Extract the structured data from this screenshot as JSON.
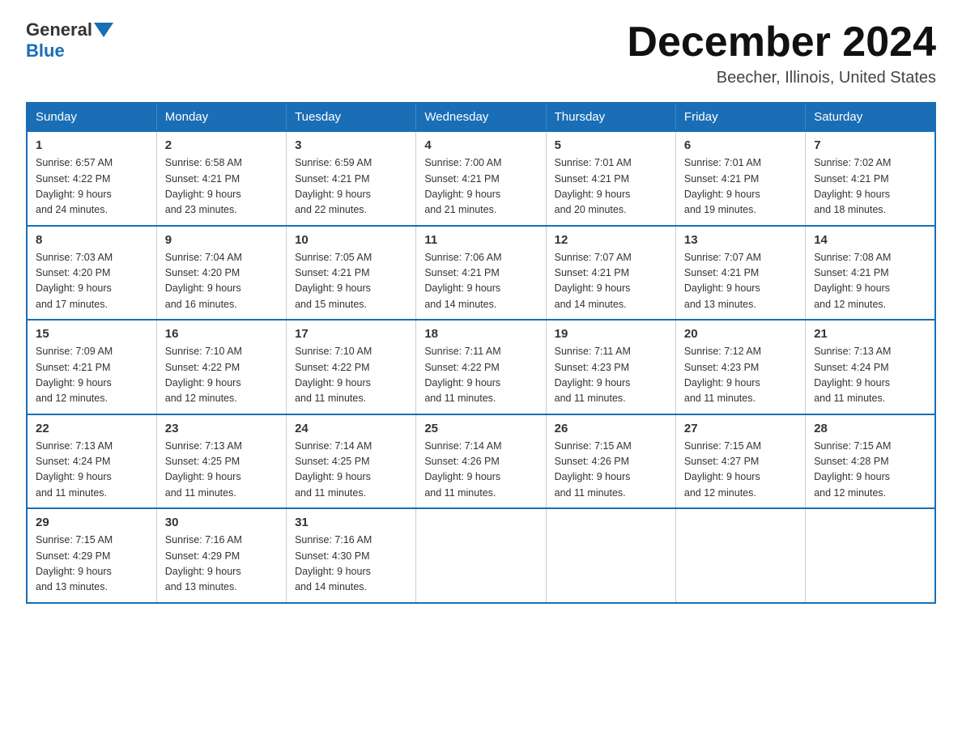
{
  "logo": {
    "general": "General",
    "blue": "Blue"
  },
  "header": {
    "month_year": "December 2024",
    "location": "Beecher, Illinois, United States"
  },
  "days_of_week": [
    "Sunday",
    "Monday",
    "Tuesday",
    "Wednesday",
    "Thursday",
    "Friday",
    "Saturday"
  ],
  "weeks": [
    [
      {
        "day": "1",
        "info": "Sunrise: 6:57 AM\nSunset: 4:22 PM\nDaylight: 9 hours\nand 24 minutes."
      },
      {
        "day": "2",
        "info": "Sunrise: 6:58 AM\nSunset: 4:21 PM\nDaylight: 9 hours\nand 23 minutes."
      },
      {
        "day": "3",
        "info": "Sunrise: 6:59 AM\nSunset: 4:21 PM\nDaylight: 9 hours\nand 22 minutes."
      },
      {
        "day": "4",
        "info": "Sunrise: 7:00 AM\nSunset: 4:21 PM\nDaylight: 9 hours\nand 21 minutes."
      },
      {
        "day": "5",
        "info": "Sunrise: 7:01 AM\nSunset: 4:21 PM\nDaylight: 9 hours\nand 20 minutes."
      },
      {
        "day": "6",
        "info": "Sunrise: 7:01 AM\nSunset: 4:21 PM\nDaylight: 9 hours\nand 19 minutes."
      },
      {
        "day": "7",
        "info": "Sunrise: 7:02 AM\nSunset: 4:21 PM\nDaylight: 9 hours\nand 18 minutes."
      }
    ],
    [
      {
        "day": "8",
        "info": "Sunrise: 7:03 AM\nSunset: 4:20 PM\nDaylight: 9 hours\nand 17 minutes."
      },
      {
        "day": "9",
        "info": "Sunrise: 7:04 AM\nSunset: 4:20 PM\nDaylight: 9 hours\nand 16 minutes."
      },
      {
        "day": "10",
        "info": "Sunrise: 7:05 AM\nSunset: 4:21 PM\nDaylight: 9 hours\nand 15 minutes."
      },
      {
        "day": "11",
        "info": "Sunrise: 7:06 AM\nSunset: 4:21 PM\nDaylight: 9 hours\nand 14 minutes."
      },
      {
        "day": "12",
        "info": "Sunrise: 7:07 AM\nSunset: 4:21 PM\nDaylight: 9 hours\nand 14 minutes."
      },
      {
        "day": "13",
        "info": "Sunrise: 7:07 AM\nSunset: 4:21 PM\nDaylight: 9 hours\nand 13 minutes."
      },
      {
        "day": "14",
        "info": "Sunrise: 7:08 AM\nSunset: 4:21 PM\nDaylight: 9 hours\nand 12 minutes."
      }
    ],
    [
      {
        "day": "15",
        "info": "Sunrise: 7:09 AM\nSunset: 4:21 PM\nDaylight: 9 hours\nand 12 minutes."
      },
      {
        "day": "16",
        "info": "Sunrise: 7:10 AM\nSunset: 4:22 PM\nDaylight: 9 hours\nand 12 minutes."
      },
      {
        "day": "17",
        "info": "Sunrise: 7:10 AM\nSunset: 4:22 PM\nDaylight: 9 hours\nand 11 minutes."
      },
      {
        "day": "18",
        "info": "Sunrise: 7:11 AM\nSunset: 4:22 PM\nDaylight: 9 hours\nand 11 minutes."
      },
      {
        "day": "19",
        "info": "Sunrise: 7:11 AM\nSunset: 4:23 PM\nDaylight: 9 hours\nand 11 minutes."
      },
      {
        "day": "20",
        "info": "Sunrise: 7:12 AM\nSunset: 4:23 PM\nDaylight: 9 hours\nand 11 minutes."
      },
      {
        "day": "21",
        "info": "Sunrise: 7:13 AM\nSunset: 4:24 PM\nDaylight: 9 hours\nand 11 minutes."
      }
    ],
    [
      {
        "day": "22",
        "info": "Sunrise: 7:13 AM\nSunset: 4:24 PM\nDaylight: 9 hours\nand 11 minutes."
      },
      {
        "day": "23",
        "info": "Sunrise: 7:13 AM\nSunset: 4:25 PM\nDaylight: 9 hours\nand 11 minutes."
      },
      {
        "day": "24",
        "info": "Sunrise: 7:14 AM\nSunset: 4:25 PM\nDaylight: 9 hours\nand 11 minutes."
      },
      {
        "day": "25",
        "info": "Sunrise: 7:14 AM\nSunset: 4:26 PM\nDaylight: 9 hours\nand 11 minutes."
      },
      {
        "day": "26",
        "info": "Sunrise: 7:15 AM\nSunset: 4:26 PM\nDaylight: 9 hours\nand 11 minutes."
      },
      {
        "day": "27",
        "info": "Sunrise: 7:15 AM\nSunset: 4:27 PM\nDaylight: 9 hours\nand 12 minutes."
      },
      {
        "day": "28",
        "info": "Sunrise: 7:15 AM\nSunset: 4:28 PM\nDaylight: 9 hours\nand 12 minutes."
      }
    ],
    [
      {
        "day": "29",
        "info": "Sunrise: 7:15 AM\nSunset: 4:29 PM\nDaylight: 9 hours\nand 13 minutes."
      },
      {
        "day": "30",
        "info": "Sunrise: 7:16 AM\nSunset: 4:29 PM\nDaylight: 9 hours\nand 13 minutes."
      },
      {
        "day": "31",
        "info": "Sunrise: 7:16 AM\nSunset: 4:30 PM\nDaylight: 9 hours\nand 14 minutes."
      },
      {
        "day": "",
        "info": ""
      },
      {
        "day": "",
        "info": ""
      },
      {
        "day": "",
        "info": ""
      },
      {
        "day": "",
        "info": ""
      }
    ]
  ]
}
